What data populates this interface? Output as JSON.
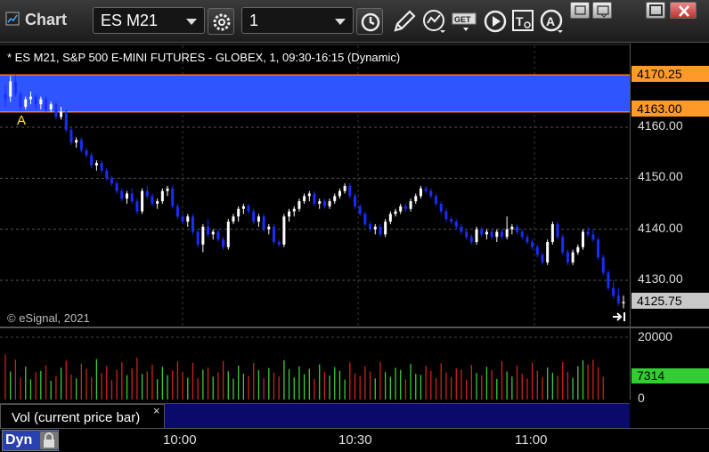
{
  "window": {
    "title": "Chart"
  },
  "toolbar": {
    "symbol": "ES M21",
    "interval": "1"
  },
  "chart": {
    "description": "* ES M21, S&P 500 E-MINI FUTURES - GLOBEX, 1, 09:30-16:15 (Dynamic)",
    "copyright": "© eSignal, 2021",
    "annotation": "A",
    "price_ticks": [
      "4160.00",
      "4150.00",
      "4140.00",
      "4130.00"
    ],
    "tag_upper": "4170.25",
    "tag_lower": "4163.00",
    "tag_last": "4125.75",
    "colors": {
      "zone": "#2f55ff",
      "zone_line": "#ff7a1a",
      "tag_orange": "#ff9a2a",
      "up": "#ffffff",
      "down": "#1a2cff",
      "vol_up": "#3dcc3d",
      "vol_down": "#cc2222",
      "tag_last": "#c8c8c8",
      "tag_vol": "#33cc33"
    }
  },
  "volume": {
    "label": "Vol (current price bar)",
    "close_glyph": "×",
    "ticks": [
      "20000",
      "0"
    ],
    "current": "7314"
  },
  "time_axis": {
    "labels": [
      "10:00",
      "10:30",
      "11:00"
    ],
    "dyn_label": "Dyn"
  },
  "chart_data": {
    "type": "candlestick",
    "y_range": [
      4122,
      4172
    ],
    "zone": {
      "upper": 4170.25,
      "lower": 4163.0
    },
    "last_price": 4125.75,
    "candles": [
      [
        4166.5,
        4168,
        4164,
        4165.5
      ],
      [
        4166,
        4170,
        4165,
        4169
      ],
      [
        4169,
        4170.2,
        4166,
        4166.5
      ],
      [
        4166.5,
        4167,
        4163.2,
        4164
      ],
      [
        4164,
        4166,
        4163.5,
        4165.5
      ],
      [
        4165.5,
        4167,
        4164.5,
        4166
      ],
      [
        4166,
        4166.5,
        4163.5,
        4164.5
      ],
      [
        4164.5,
        4166,
        4163.5,
        4165.5
      ],
      [
        4165.5,
        4166,
        4163,
        4163.5
      ],
      [
        4163.5,
        4165,
        4163,
        4164.5
      ],
      [
        4164.5,
        4165,
        4161.5,
        4162
      ],
      [
        4162,
        4164,
        4161.5,
        4163
      ],
      [
        4163,
        4163.5,
        4159,
        4159.5
      ],
      [
        4159.5,
        4160,
        4156.5,
        4157
      ],
      [
        4157,
        4158,
        4156,
        4157.5
      ],
      [
        4157.5,
        4158,
        4155,
        4155.5
      ],
      [
        4155.5,
        4156,
        4154,
        4154.5
      ],
      [
        4154.5,
        4155,
        4152,
        4152.5
      ],
      [
        4152.5,
        4153.5,
        4151.5,
        4153
      ],
      [
        4153,
        4153.5,
        4151,
        4151.5
      ],
      [
        4151.5,
        4152,
        4149.5,
        4150
      ],
      [
        4150,
        4150.5,
        4148.5,
        4149
      ],
      [
        4149,
        4149.5,
        4147,
        4147.5
      ],
      [
        4147.5,
        4148,
        4145.5,
        4146
      ],
      [
        4146,
        4147.5,
        4145,
        4147
      ],
      [
        4147,
        4148,
        4145,
        4145.5
      ],
      [
        4145.5,
        4146,
        4143,
        4143.5
      ],
      [
        4143.5,
        4148,
        4143,
        4147.5
      ],
      [
        4147.5,
        4148.5,
        4146,
        4146.5
      ],
      [
        4146.5,
        4147,
        4144.5,
        4145
      ],
      [
        4145,
        4146,
        4144,
        4145.5
      ],
      [
        4145.5,
        4148,
        4145,
        4147.5
      ],
      [
        4147.5,
        4148.5,
        4146.5,
        4148
      ],
      [
        4148,
        4148.5,
        4144,
        4144.5
      ],
      [
        4144.5,
        4145,
        4142,
        4142.5
      ],
      [
        4142.5,
        4143,
        4141,
        4141.5
      ],
      [
        4141.5,
        4143,
        4140.5,
        4142.5
      ],
      [
        4142.5,
        4143,
        4139,
        4139.5
      ],
      [
        4139.5,
        4140,
        4136.5,
        4137
      ],
      [
        4137,
        4141,
        4135.5,
        4140.5
      ],
      [
        4140.5,
        4142,
        4138.5,
        4139
      ],
      [
        4139,
        4140,
        4138,
        4139.5
      ],
      [
        4139.5,
        4140,
        4137.5,
        4138
      ],
      [
        4138,
        4138.5,
        4136,
        4136.5
      ],
      [
        4136.5,
        4142,
        4136,
        4141.5
      ],
      [
        4141.5,
        4143,
        4141,
        4142.5
      ],
      [
        4142.5,
        4144.5,
        4141.5,
        4144
      ],
      [
        4144,
        4145,
        4143,
        4144.5
      ],
      [
        4144.5,
        4145,
        4143,
        4143.5
      ],
      [
        4143.5,
        4144,
        4141,
        4141.5
      ],
      [
        4141.5,
        4143,
        4140.5,
        4142.5
      ],
      [
        4142.5,
        4143,
        4139.5,
        4140
      ],
      [
        4140,
        4141,
        4139,
        4140.5
      ],
      [
        4140.5,
        4141,
        4137,
        4137.5
      ],
      [
        4137.5,
        4138,
        4136.5,
        4137
      ],
      [
        4137,
        4143,
        4136.5,
        4142.5
      ],
      [
        4142.5,
        4144,
        4141.5,
        4143.5
      ],
      [
        4143.5,
        4144.5,
        4142.5,
        4144
      ],
      [
        4144,
        4146,
        4143.5,
        4145.5
      ],
      [
        4145.5,
        4147,
        4145,
        4146.5
      ],
      [
        4146.5,
        4147.5,
        4145.5,
        4147
      ],
      [
        4147,
        4147.5,
        4144.5,
        4145
      ],
      [
        4145,
        4146,
        4144,
        4145.5
      ],
      [
        4145.5,
        4146,
        4144,
        4144.5
      ],
      [
        4144.5,
        4146,
        4144,
        4145.5
      ],
      [
        4145.5,
        4147,
        4145,
        4146.5
      ],
      [
        4146.5,
        4148,
        4146,
        4147.5
      ],
      [
        4147.5,
        4149,
        4147,
        4148.5
      ],
      [
        4148.5,
        4149,
        4146,
        4146.5
      ],
      [
        4146.5,
        4147,
        4144,
        4144.5
      ],
      [
        4144.5,
        4145,
        4142.5,
        4143
      ],
      [
        4143,
        4143.5,
        4140.5,
        4141
      ],
      [
        4141,
        4141.5,
        4139.5,
        4140
      ],
      [
        4140,
        4141,
        4139,
        4140.5
      ],
      [
        4140.5,
        4141,
        4138.5,
        4139
      ],
      [
        4139,
        4142,
        4138.5,
        4141.5
      ],
      [
        4141.5,
        4143.5,
        4141,
        4143
      ],
      [
        4143,
        4144,
        4142.5,
        4143.5
      ],
      [
        4143.5,
        4145,
        4143,
        4144.5
      ],
      [
        4144.5,
        4145,
        4143.5,
        4144
      ],
      [
        4144,
        4146,
        4143.5,
        4145.5
      ],
      [
        4145.5,
        4147,
        4145,
        4146.5
      ],
      [
        4146.5,
        4148.5,
        4146,
        4148
      ],
      [
        4148,
        4148.5,
        4147,
        4147.5
      ],
      [
        4147.5,
        4148,
        4146,
        4146.5
      ],
      [
        4146.5,
        4147,
        4144.5,
        4145
      ],
      [
        4145,
        4145.5,
        4143,
        4143.5
      ],
      [
        4143.5,
        4144,
        4141.5,
        4142
      ],
      [
        4142,
        4142.5,
        4141,
        4141.5
      ],
      [
        4141.5,
        4142,
        4140,
        4140.5
      ],
      [
        4140.5,
        4141,
        4139,
        4139.5
      ],
      [
        4139.5,
        4140,
        4138,
        4138.5
      ],
      [
        4138.5,
        4139,
        4137,
        4137.5
      ],
      [
        4137.5,
        4140.5,
        4137,
        4140
      ],
      [
        4140,
        4140.5,
        4138.5,
        4139
      ],
      [
        4139,
        4140,
        4138,
        4139.5
      ],
      [
        4139.5,
        4140,
        4138,
        4138.5
      ],
      [
        4138.5,
        4140,
        4137.5,
        4139.5
      ],
      [
        4139.5,
        4140,
        4138,
        4138.5
      ],
      [
        4138.5,
        4142.5,
        4138,
        4140
      ],
      [
        4140,
        4141,
        4139,
        4140.5
      ],
      [
        4140.5,
        4141,
        4139,
        4139.5
      ],
      [
        4139.5,
        4140,
        4138,
        4138.5
      ],
      [
        4138.5,
        4139,
        4137,
        4137.5
      ],
      [
        4137.5,
        4138,
        4136,
        4136.5
      ],
      [
        4136.5,
        4137,
        4134.5,
        4135
      ],
      [
        4135,
        4135.5,
        4133,
        4133.5
      ],
      [
        4133.5,
        4138,
        4133,
        4137.5
      ],
      [
        4137.5,
        4141.5,
        4137,
        4141
      ],
      [
        4141,
        4141.5,
        4138,
        4138.5
      ],
      [
        4138.5,
        4139,
        4135,
        4135.5
      ],
      [
        4135.5,
        4136,
        4133,
        4133.5
      ],
      [
        4133.5,
        4136,
        4133,
        4135.5
      ],
      [
        4135.5,
        4137,
        4135,
        4136.5
      ],
      [
        4136.5,
        4140,
        4136,
        4139.5
      ],
      [
        4139.5,
        4140.5,
        4138.5,
        4139
      ],
      [
        4139,
        4140,
        4137.5,
        4138
      ],
      [
        4138,
        4138.5,
        4134,
        4134.5
      ],
      [
        4134.5,
        4135,
        4131,
        4131.5
      ],
      [
        4131.5,
        4132,
        4128,
        4128.5
      ],
      [
        4128.5,
        4130,
        4126.5,
        4127
      ],
      [
        4127,
        4128.5,
        4125,
        4125.5
      ],
      [
        4125.5,
        4127,
        4124.5,
        4125.75
      ]
    ],
    "volume": [
      14500,
      9000,
      12800,
      7000,
      10500,
      6500,
      8800,
      9200,
      11000,
      6000,
      7500,
      10200,
      12500,
      8000,
      6800,
      11500,
      9800,
      7200,
      13000,
      8500,
      10800,
      6200,
      9500,
      12000,
      7800,
      10000,
      13500,
      8200,
      9000,
      11200,
      6500,
      10500,
      7800,
      9300,
      12200,
      8800,
      7000,
      11800,
      6800,
      9600,
      10300,
      7300,
      8700,
      12400,
      9100,
      6700,
      10900,
      8300,
      7600,
      11700,
      9400,
      6900,
      10100,
      8600,
      7400,
      12600,
      9700,
      7100,
      10600,
      8100,
      9900,
      6600,
      11300,
      8900,
      7700,
      10400,
      9200,
      6400,
      11900,
      8400,
      7500,
      10700,
      9000,
      6800,
      12100,
      8800,
      7300,
      10200,
      9500,
      6500,
      11400,
      8200,
      7900,
      10800,
      9300,
      6900,
      11600,
      8700,
      7200,
      10000,
      9600,
      6300,
      11100,
      8500,
      7800,
      10500,
      9400,
      6600,
      12300,
      9000,
      7400,
      10900,
      8300,
      6700,
      11800,
      9200,
      7100,
      10300,
      8600,
      7600,
      12000,
      8900,
      7000,
      10700,
      12600,
      11200,
      12800,
      10400,
      7314
    ],
    "vol_range": [
      0,
      20000
    ]
  }
}
